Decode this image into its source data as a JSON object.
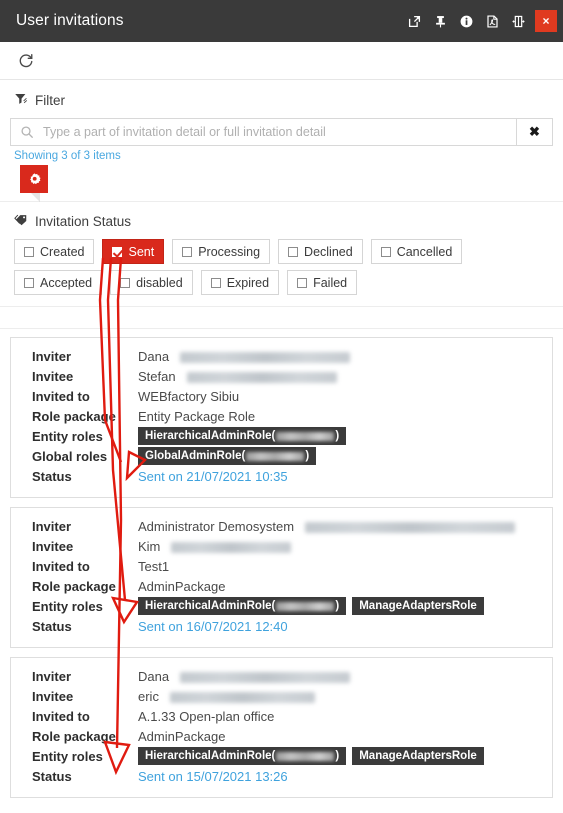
{
  "window": {
    "title": "User invitations",
    "actions": [
      {
        "name": "popout-icon",
        "label": "Open in new window"
      },
      {
        "name": "pin-icon",
        "label": "Pin"
      },
      {
        "name": "info-icon",
        "label": "Info"
      },
      {
        "name": "pdf-icon",
        "label": "Export PDF"
      },
      {
        "name": "collapse-icon",
        "label": "Collapse"
      }
    ],
    "close_label": "×"
  },
  "toolbar": {
    "refresh_icon": "refresh-icon",
    "refresh_label": "Refresh"
  },
  "filter": {
    "icon": "filter-icon",
    "title": "Filter",
    "search_placeholder": "Type a part of invitation detail or full invitation detail",
    "search_value": "",
    "search_icon": "search-icon",
    "clear_label": "✖",
    "showing_text": "Showing 3 of 3 items",
    "settings_icon": "gear-icon"
  },
  "invitation_status": {
    "icon": "tag-icon",
    "title": "Invitation Status",
    "chips": [
      {
        "label": "Created",
        "checked": false
      },
      {
        "label": "Sent",
        "checked": true
      },
      {
        "label": "Processing",
        "checked": false
      },
      {
        "label": "Declined",
        "checked": false
      },
      {
        "label": "Cancelled",
        "checked": false
      },
      {
        "label": "Accepted",
        "checked": false
      },
      {
        "label": "disabled",
        "checked": false
      },
      {
        "label": "Expired",
        "checked": false
      },
      {
        "label": "Failed",
        "checked": false
      }
    ]
  },
  "labels": {
    "inviter": "Inviter",
    "invitee": "Invitee",
    "invited_to": "Invited to",
    "role_package": "Role package",
    "entity_roles": "Entity roles",
    "global_roles": "Global roles",
    "status": "Status"
  },
  "cards": [
    {
      "inviter": "Dana",
      "inviter_email_redacted": true,
      "invitee": "Stefan",
      "invitee_email_redacted": true,
      "invited_to": "WEBfactory Sibiu",
      "role_package": "Entity Package Role",
      "entity_roles": [
        {
          "text": "HierarchicalAdminRole(",
          "redacted": true,
          "suffix": ")"
        }
      ],
      "global_roles": [
        {
          "text": "GlobalAdminRole(",
          "redacted": true,
          "suffix": ")"
        }
      ],
      "status": "Sent on 21/07/2021 10:35"
    },
    {
      "inviter": "Administrator Demosystem",
      "inviter_email_redacted": true,
      "invitee": "Kim",
      "invitee_email_redacted": true,
      "invited_to": "Test1",
      "role_package": "AdminPackage",
      "entity_roles": [
        {
          "text": "HierarchicalAdminRole(",
          "redacted": true,
          "suffix": ")"
        },
        {
          "text": "ManageAdaptersRole",
          "redacted": false,
          "suffix": ""
        }
      ],
      "global_roles": [],
      "status": "Sent on 16/07/2021 12:40"
    },
    {
      "inviter": "Dana",
      "inviter_email_redacted": true,
      "invitee": "eric",
      "invitee_email_redacted": true,
      "invited_to": "A.1.33 Open-plan office",
      "role_package": "AdminPackage",
      "entity_roles": [
        {
          "text": "HierarchicalAdminRole(",
          "redacted": true,
          "suffix": ")"
        },
        {
          "text": "ManageAdaptersRole",
          "redacted": false,
          "suffix": ""
        }
      ],
      "global_roles": [],
      "status": "Sent on 15/07/2021 13:26"
    }
  ],
  "colors": {
    "accent_red": "#d9291c",
    "titlebar": "#3a3a3a",
    "link_blue": "#3fa2dd",
    "badge_dark": "#3b3b3b",
    "annotation_red": "#e01b10"
  },
  "annotations": {
    "description": "Three red arrows drawn from the Sent status filter chip down to the Entity/Global roles rows of each invitation card",
    "count": 3
  }
}
